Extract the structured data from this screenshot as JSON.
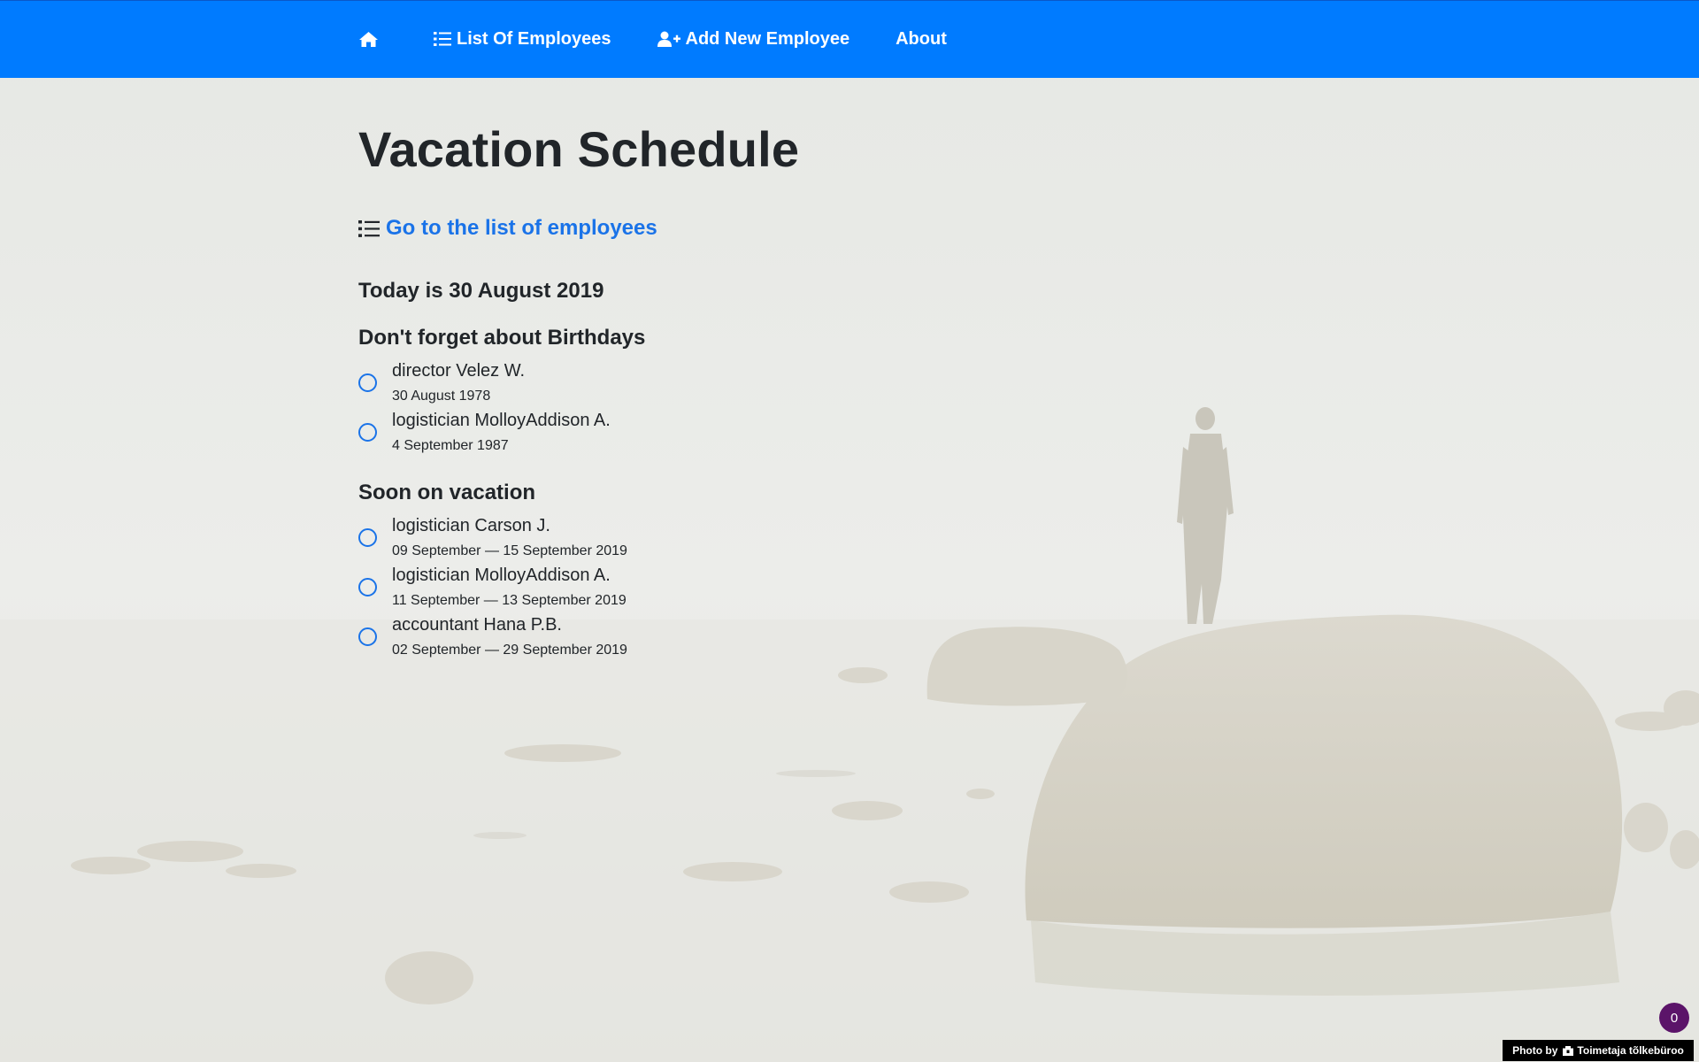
{
  "nav": {
    "home_icon": "home-icon",
    "items": [
      {
        "label": "List Of Employees",
        "icon": "list-icon"
      },
      {
        "label": "Add New Employee",
        "icon": "user-plus-icon"
      },
      {
        "label": "About"
      }
    ],
    "color": "#007bff"
  },
  "main": {
    "title": "Vacation Schedule",
    "list_link": {
      "label": "Go to the list of employees",
      "icon": "list-icon"
    },
    "today": "Today is 30 August 2019"
  },
  "birthdays": {
    "title": "Don't forget about Birthdays",
    "items": [
      {
        "name": "director Velez W.",
        "date": "30 August 1978"
      },
      {
        "name": "logistician MolloyAddison A.",
        "date": "4 September 1987"
      }
    ]
  },
  "vacation": {
    "title": "Soon on vacation",
    "items": [
      {
        "name": "logistician Carson J.",
        "date": "09 September — 15 September 2019"
      },
      {
        "name": "logistician MolloyAddison A.",
        "date": "11 September — 13 September 2019"
      },
      {
        "name": "accountant Hana P.B.",
        "date": "02 September — 29 September 2019"
      }
    ]
  },
  "badge": {
    "count": "0"
  },
  "credit": {
    "prefix": "Photo by",
    "author": "Toimetaja tõlkebüroo",
    "icon": "camera-icon"
  },
  "colors": {
    "accent": "#1a73e8",
    "badge": "#5b1469"
  }
}
